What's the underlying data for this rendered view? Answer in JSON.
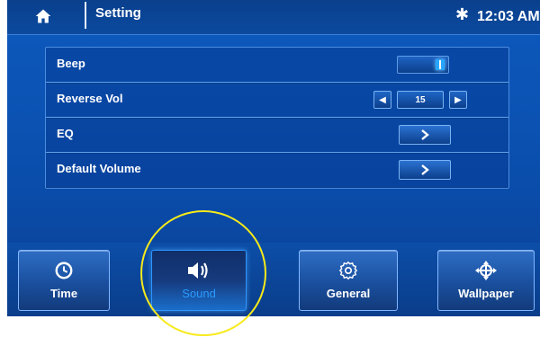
{
  "header": {
    "title": "Setting",
    "time": "12:03 AM",
    "bluetooth_icon": "bluetooth-icon",
    "home_icon": "home-icon"
  },
  "settings": [
    {
      "label": "Beep",
      "control": "toggle",
      "state": "on"
    },
    {
      "label": "Reverse Vol",
      "control": "stepper",
      "value": "15"
    },
    {
      "label": "EQ",
      "control": "chevron"
    },
    {
      "label": "Default Volume",
      "control": "chevron"
    }
  ],
  "nav": [
    {
      "label": "Time",
      "icon": "clock-icon",
      "active": false
    },
    {
      "label": "Sound",
      "icon": "speaker-icon",
      "active": true
    },
    {
      "label": "General",
      "icon": "gear-icon",
      "active": false
    },
    {
      "label": "Wallpaper",
      "icon": "wallpaper-icon",
      "active": false
    }
  ],
  "colors": {
    "background": "#0b52b2",
    "active_label": "#2b9bff",
    "annotation": "#f7ea1a"
  }
}
